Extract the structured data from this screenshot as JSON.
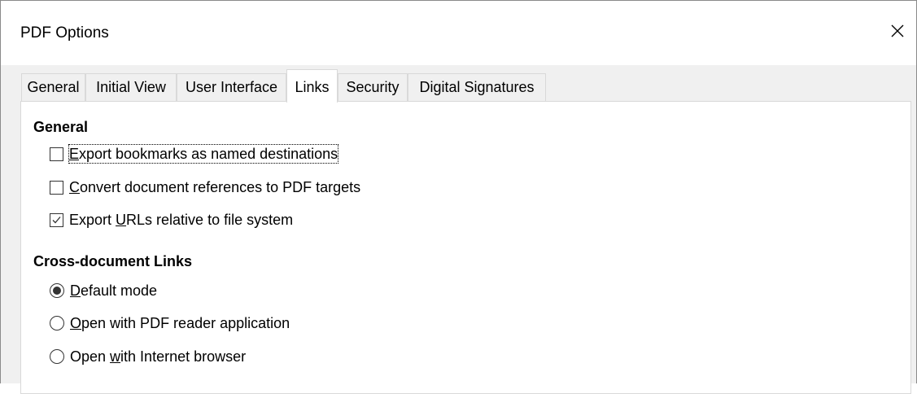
{
  "window": {
    "title": "PDF Options",
    "close_icon": "close-icon"
  },
  "tabs": [
    {
      "label": "General",
      "active": false
    },
    {
      "label": "Initial View",
      "active": false
    },
    {
      "label": "User Interface",
      "active": false
    },
    {
      "label": "Links",
      "active": true
    },
    {
      "label": "Security",
      "active": false
    },
    {
      "label": "Digital Signatures",
      "active": false
    }
  ],
  "general_section": {
    "title": "General",
    "options": [
      {
        "pre": "",
        "mnemonic": "E",
        "post": "xport bookmarks as named destinations",
        "checked": false,
        "focused": true
      },
      {
        "pre": "",
        "mnemonic": "C",
        "post": "onvert document references to PDF targets",
        "checked": false,
        "focused": false
      },
      {
        "pre": "Export ",
        "mnemonic": "U",
        "post": "RLs relative to file system",
        "checked": true,
        "focused": false
      }
    ]
  },
  "crossdoc_section": {
    "title": "Cross-document Links",
    "options": [
      {
        "pre": "",
        "mnemonic": "D",
        "post": "efault mode",
        "selected": true
      },
      {
        "pre": "",
        "mnemonic": "O",
        "post": "pen with PDF reader application",
        "selected": false
      },
      {
        "pre": "Open ",
        "mnemonic": "w",
        "post": "ith Internet browser",
        "selected": false
      }
    ]
  }
}
